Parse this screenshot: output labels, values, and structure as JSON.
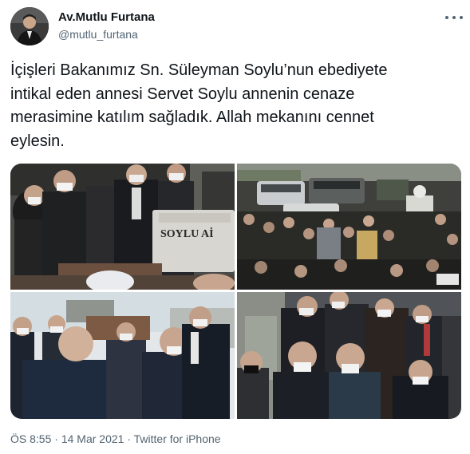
{
  "author": {
    "display_name": "Av.Mutlu Furtana",
    "handle": "@mutlu_furtana",
    "avatar_icon": "profile-photo"
  },
  "tweet": {
    "text": "İçişleri Bakanımız Sn. Süleyman Soylu’nun ebediyete\nintikal eden annesi Servet Soylu annenin cenaze\nmerasimine katılım sağladık. Allah mekanını cennet\neylesin.",
    "photo_1_sign": "SOYLU Aİ"
  },
  "meta": {
    "time": "ÖS 8:55",
    "separator_1": " · ",
    "date": "14 Mar 2021",
    "separator_2": " · ",
    "source": "Twitter for iPhone"
  },
  "colors": {
    "text": "#0f1419",
    "secondary": "#536471",
    "background": "#ffffff"
  }
}
